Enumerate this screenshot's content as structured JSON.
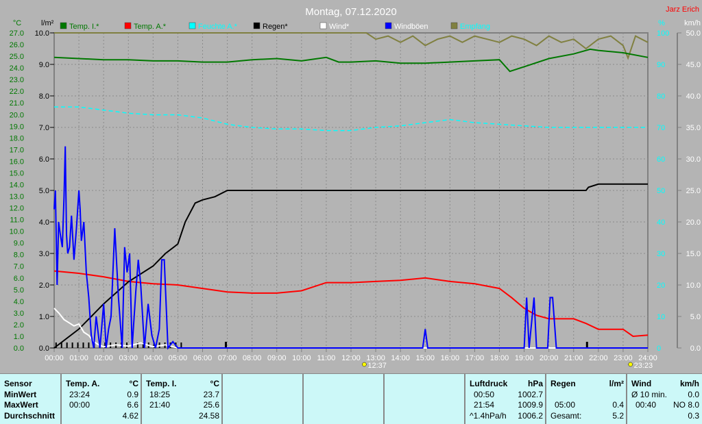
{
  "title": "Montag, 07.12.2020",
  "author": "Jarz Erich",
  "colors": {
    "temp_i": "#007800",
    "temp_a": "#ff0000",
    "humidity": "#00ffff",
    "rain": "#000000",
    "wind": "#ffffff",
    "gusts": "#0000ff",
    "reception": "#808040"
  },
  "chart_data": {
    "type": "line",
    "title": "Montag, 07.12.2020",
    "legend": [
      "Temp. I.*",
      "Temp. A.*",
      "Feuchte A.*",
      "Regen*",
      "Wind*",
      "Windböen",
      "Empfang"
    ],
    "legend_placement": "top",
    "grid": true,
    "x_ticks": [
      "00:00",
      "01:00",
      "02:00",
      "03:00",
      "04:00",
      "05:00",
      "06:00",
      "07:00",
      "08:00",
      "09:00",
      "10:00",
      "11:00",
      "12:00",
      "13:00",
      "14:00",
      "15:00",
      "16:00",
      "17:00",
      "18:00",
      "19:00",
      "20:00",
      "21:00",
      "22:00",
      "23:00",
      "24:00"
    ],
    "xlim": [
      0,
      24
    ],
    "axes": {
      "temp": {
        "unit": "°C",
        "ylim": [
          0,
          27
        ],
        "ticks": [
          "0.0",
          "1.0",
          "2.0",
          "3.0",
          "4.0",
          "5.0",
          "6.0",
          "7.0",
          "8.0",
          "9.0",
          "10.0",
          "11.0",
          "12.0",
          "13.0",
          "14.0",
          "15.0",
          "16.0",
          "17.0",
          "18.0",
          "19.0",
          "20.0",
          "21.0",
          "22.0",
          "23.0",
          "24.0",
          "25.0",
          "26.0",
          "27.0"
        ]
      },
      "rain": {
        "unit": "l/m²",
        "ylim": [
          0,
          10
        ],
        "ticks": [
          "0.0",
          "1.0",
          "2.0",
          "3.0",
          "4.0",
          "5.0",
          "6.0",
          "7.0",
          "8.0",
          "9.0",
          "10.0"
        ]
      },
      "humidity": {
        "unit": "%",
        "ylim": [
          0,
          100
        ],
        "ticks": [
          "0",
          "10",
          "20",
          "30",
          "40",
          "50",
          "60",
          "70",
          "80",
          "90",
          "100"
        ]
      },
      "wind": {
        "unit": "km/h",
        "ylim": [
          0,
          50
        ],
        "ticks": [
          "0.0",
          "5.0",
          "10.0",
          "15.0",
          "20.0",
          "25.0",
          "30.0",
          "35.0",
          "40.0",
          "45.0",
          "50.0"
        ]
      }
    },
    "events": [
      {
        "label": "12:37",
        "t": 12.62,
        "icon": "sunrise"
      },
      {
        "label": "23:23",
        "t": 23.38,
        "icon": "sunset"
      }
    ],
    "series": [
      {
        "name": "Temp. I.*",
        "axis": "temp",
        "color": "#007800",
        "x": [
          0,
          1,
          2,
          3,
          4,
          5,
          6,
          7,
          8,
          9,
          10,
          11,
          11.5,
          12,
          13,
          14,
          15,
          16,
          17,
          18,
          18.42,
          19,
          20,
          21,
          21.67,
          22,
          23,
          24
        ],
        "y": [
          24.9,
          24.8,
          24.7,
          24.7,
          24.6,
          24.6,
          24.5,
          24.5,
          24.7,
          24.8,
          24.6,
          24.9,
          24.5,
          24.5,
          24.6,
          24.4,
          24.4,
          24.5,
          24.6,
          24.7,
          23.7,
          24.1,
          24.8,
          25.2,
          25.6,
          25.5,
          25.3,
          24.9
        ]
      },
      {
        "name": "Temp. A.*",
        "axis": "temp",
        "color": "#ff0000",
        "x": [
          0,
          1,
          2,
          3,
          4,
          5,
          6,
          7,
          8,
          9,
          10,
          11,
          12,
          13,
          14,
          15,
          16,
          17,
          18,
          18.5,
          19,
          19.5,
          20,
          21,
          21.5,
          22,
          23,
          23.4,
          24
        ],
        "y": [
          6.6,
          6.4,
          6.1,
          5.7,
          5.5,
          5.4,
          5.1,
          4.8,
          4.7,
          4.7,
          4.9,
          5.6,
          5.6,
          5.7,
          5.8,
          6.0,
          5.7,
          5.5,
          5.1,
          4.3,
          3.4,
          2.8,
          2.5,
          2.5,
          2.1,
          1.6,
          1.6,
          1.0,
          1.1
        ]
      },
      {
        "name": "Feuchte A.*",
        "axis": "humidity",
        "color": "#00ffff",
        "x": [
          0,
          1,
          2,
          3,
          4,
          5,
          6,
          7,
          8,
          9,
          10,
          11,
          12,
          13,
          14,
          15,
          16,
          17,
          18,
          19,
          20,
          21,
          22,
          23,
          24
        ],
        "y": [
          76.5,
          76.5,
          75.5,
          74.5,
          74,
          74,
          73,
          71,
          70,
          69.5,
          69.5,
          69,
          69,
          70,
          70.5,
          71.5,
          72.5,
          71.5,
          71,
          70.5,
          70,
          70,
          70,
          70,
          70
        ]
      },
      {
        "name": "Regen*",
        "axis": "rain",
        "color": "#000000",
        "x": [
          0,
          1,
          2,
          3,
          4,
          4.5,
          5,
          5.3,
          5.7,
          6,
          6.5,
          7,
          8,
          12,
          18,
          21.5,
          21.6,
          22,
          24
        ],
        "y": [
          0,
          0.6,
          1.4,
          2.1,
          2.6,
          3.0,
          3.3,
          4.0,
          4.6,
          4.7,
          4.8,
          5.0,
          5.0,
          5.0,
          5.0,
          5.0,
          5.1,
          5.2,
          5.2
        ]
      },
      {
        "name": "Wind*",
        "axis": "wind",
        "color": "#ffffff",
        "x": [
          0,
          0.2,
          0.4,
          0.6,
          0.8,
          1,
          1.2,
          1.4,
          1.6,
          1.8,
          2,
          2.5,
          3,
          3.5,
          4,
          4.5,
          5,
          24
        ],
        "y": [
          6.3,
          5.5,
          4.5,
          4.0,
          3.5,
          3.8,
          2.5,
          2.0,
          1.0,
          0.5,
          0.2,
          0.5,
          0.3,
          0.8,
          0.2,
          0.5,
          0,
          0
        ]
      },
      {
        "name": "Windböen",
        "axis": "wind",
        "color": "#0000ff",
        "x": [
          0,
          0.05,
          0.12,
          0.18,
          0.25,
          0.33,
          0.4,
          0.45,
          0.5,
          0.55,
          0.62,
          0.7,
          0.8,
          0.9,
          1.0,
          1.05,
          1.1,
          1.2,
          1.3,
          1.4,
          1.5,
          1.6,
          1.7,
          1.85,
          2.0,
          2.1,
          2.2,
          2.3,
          2.45,
          2.6,
          2.75,
          2.85,
          2.95,
          3.05,
          3.15,
          3.3,
          3.4,
          3.5,
          3.65,
          3.8,
          3.95,
          4.1,
          4.25,
          4.35,
          4.45,
          4.6,
          4.8,
          5.0,
          14.9,
          15.0,
          15.1,
          19.0,
          19.1,
          19.2,
          19.4,
          19.5,
          19.6,
          19.95,
          20.05,
          20.15,
          20.3,
          24
        ],
        "y": [
          22,
          25,
          10,
          20,
          18,
          16,
          24,
          32,
          18,
          15,
          16,
          21,
          14,
          19,
          25,
          22,
          17,
          20,
          12,
          8,
          2,
          0,
          5,
          0,
          7,
          0,
          3,
          5,
          19,
          8,
          0,
          16,
          12,
          15,
          0,
          9,
          14,
          10,
          0,
          7,
          2,
          0,
          3,
          14,
          14,
          0,
          1,
          0,
          0,
          3,
          0,
          0,
          8,
          0,
          8,
          0,
          0,
          0,
          8,
          8,
          0,
          0
        ]
      },
      {
        "name": "Empfang",
        "axis": "humidity",
        "color": "#808040",
        "x": [
          0,
          12.62,
          13,
          13.5,
          14,
          14.5,
          15,
          15.5,
          16,
          16.5,
          17,
          17.5,
          18,
          18.5,
          19,
          19.5,
          20,
          20.5,
          21,
          21.5,
          22,
          22.5,
          23,
          23.2,
          23.5,
          24
        ],
        "y": [
          100,
          100,
          98,
          99,
          97,
          99,
          96,
          98,
          99,
          97,
          99,
          98,
          97,
          99,
          98,
          96,
          99,
          97,
          98,
          95,
          98,
          99,
          96,
          92,
          99,
          97
        ]
      }
    ]
  },
  "legend_items": [
    {
      "label": "Temp. I.*",
      "color": "#007800",
      "text_color": "#007800"
    },
    {
      "label": "Temp. A.*",
      "color": "#ff0000",
      "text_color": "#007800"
    },
    {
      "label": "Feuchte A.*",
      "color": "#00ffff",
      "text_color": "#00ffff"
    },
    {
      "label": "Regen*",
      "color": "#000000",
      "text_color": "#000000"
    },
    {
      "label": "Wind*",
      "color": "#ffffff",
      "text_color": "#ffffff"
    },
    {
      "label": "Windböen",
      "color": "#0000ff",
      "text_color": "#ffffff"
    },
    {
      "label": "Empfang",
      "color": "#808040",
      "text_color": "#00ffff"
    }
  ],
  "table": {
    "sensor": {
      "h": "Sensor",
      "rows": [
        "MinWert",
        "MaxWert",
        "Durchschnitt"
      ]
    },
    "temp_a": {
      "h": "Temp. A.",
      "unit": "°C",
      "min_t": "23:24",
      "min": "0.9",
      "max_t": "00:00",
      "max": "6.6",
      "avg": "4.62"
    },
    "temp_i": {
      "h": "Temp. I.",
      "unit": "°C",
      "min_t": "18:25",
      "min": "23.7",
      "max_t": "21:40",
      "max": "25.6",
      "avg": "24.58"
    },
    "pressure": {
      "h": "Luftdruck",
      "unit": "hPa",
      "min_t": "00:50",
      "min": "1002.7",
      "max_t": "21:54",
      "max": "1009.9",
      "trend": "^1.4hPa/h",
      "avg": "1006.2"
    },
    "rain": {
      "h": "Regen",
      "unit": "l/m²",
      "max_t": "05:00",
      "max": "0.4",
      "total_label": "Gesamt:",
      "total": "5.2"
    },
    "wind": {
      "h": "Wind",
      "unit": "km/h",
      "avg_label": "Ø 10 min.",
      "avg10": "0.0",
      "max_t": "00:40",
      "max": "NO 8.0",
      "avg": "0.3"
    }
  }
}
